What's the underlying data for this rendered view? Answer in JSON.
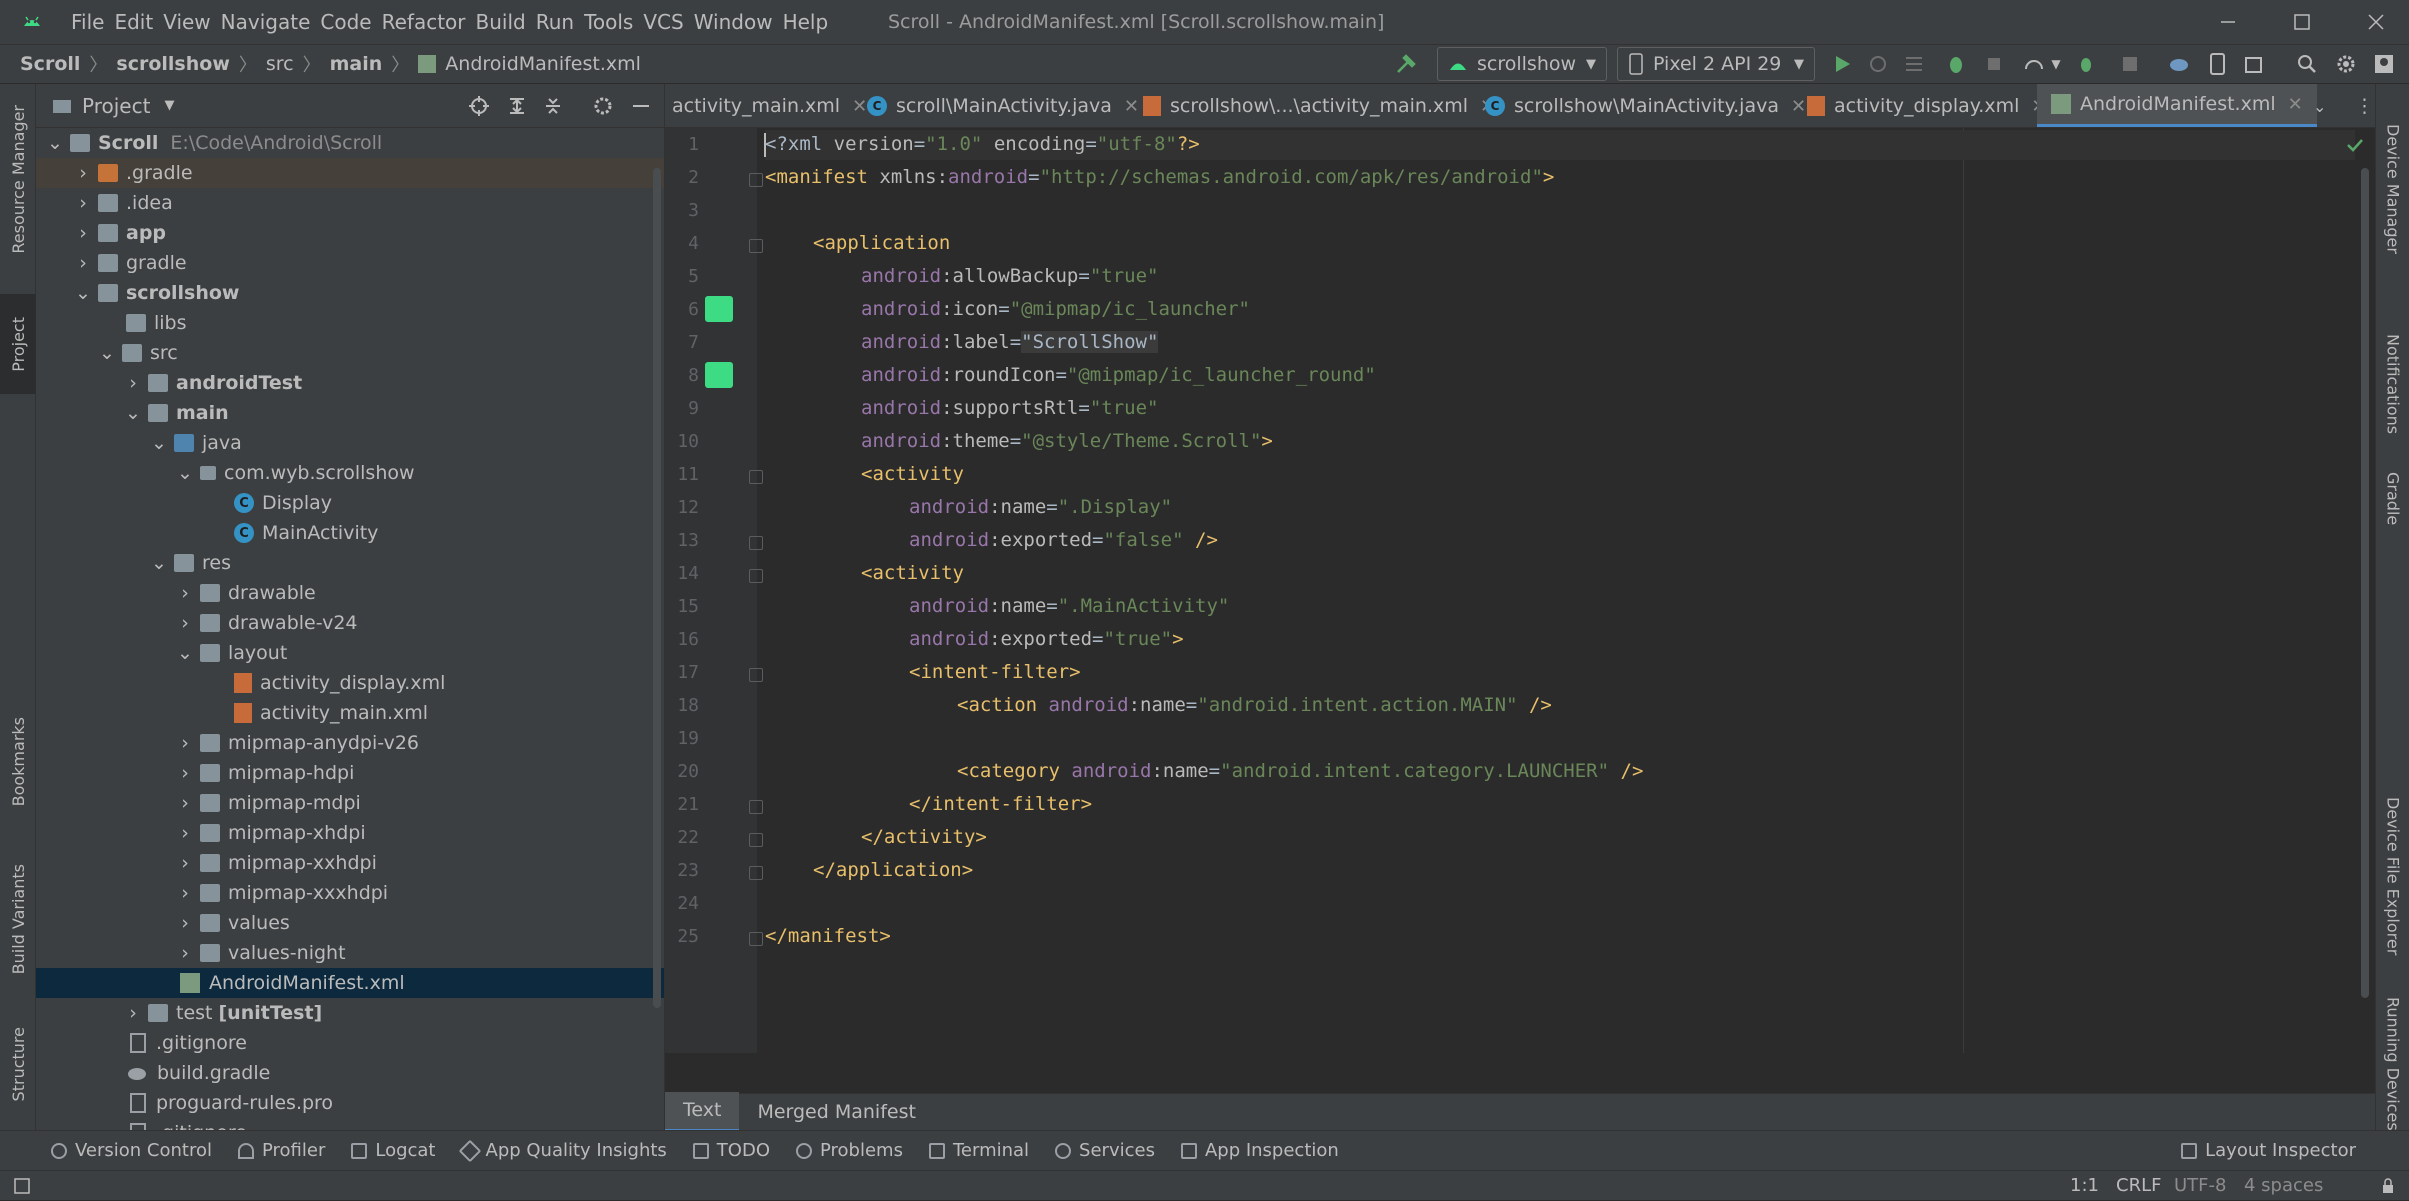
{
  "menubar": {
    "items": [
      "File",
      "Edit",
      "View",
      "Navigate",
      "Code",
      "Refactor",
      "Build",
      "Run",
      "Tools",
      "VCS",
      "Window",
      "Help"
    ],
    "window_title": "Scroll - AndroidManifest.xml [Scroll.scrollshow.main]"
  },
  "breadcrumbs": [
    "Scroll",
    "scrollshow",
    "src",
    "main",
    "AndroidManifest.xml"
  ],
  "toolbar": {
    "run_config": "scrollshow",
    "device": "Pixel 2 API 29"
  },
  "left_strip": [
    "Resource Manager",
    "Project",
    "Bookmarks",
    "Build Variants",
    "Structure"
  ],
  "right_strip": [
    "Device Manager",
    "Notifications",
    "Gradle",
    "Device File Explorer",
    "Running Devices"
  ],
  "project_panel": {
    "title": "Project",
    "tree": [
      {
        "label": "Scroll",
        "hint": "E:\\Code\\Android\\Scroll"
      },
      {
        "label": ".gradle"
      },
      {
        "label": ".idea"
      },
      {
        "label": "app"
      },
      {
        "label": "gradle"
      },
      {
        "label": "scrollshow"
      },
      {
        "label": "libs"
      },
      {
        "label": "src"
      },
      {
        "label": "androidTest"
      },
      {
        "label": "main"
      },
      {
        "label": "java"
      },
      {
        "label": "com.wyb.scrollshow"
      },
      {
        "label": "Display"
      },
      {
        "label": "MainActivity"
      },
      {
        "label": "res"
      },
      {
        "label": "drawable"
      },
      {
        "label": "drawable-v24"
      },
      {
        "label": "layout"
      },
      {
        "label": "activity_display.xml"
      },
      {
        "label": "activity_main.xml"
      },
      {
        "label": "mipmap-anydpi-v26"
      },
      {
        "label": "mipmap-hdpi"
      },
      {
        "label": "mipmap-mdpi"
      },
      {
        "label": "mipmap-xhdpi"
      },
      {
        "label": "mipmap-xxhdpi"
      },
      {
        "label": "mipmap-xxxhdpi"
      },
      {
        "label": "values"
      },
      {
        "label": "values-night"
      },
      {
        "label": "AndroidManifest.xml"
      },
      {
        "label": "test",
        "hint": "[unitTest]"
      },
      {
        "label": ".gitignore"
      },
      {
        "label": "build.gradle"
      },
      {
        "label": "proguard-rules.pro"
      },
      {
        "label": ".gitignore"
      }
    ]
  },
  "editor_tabs": [
    {
      "label": "activity_main.xml"
    },
    {
      "label": "scroll\\MainActivity.java"
    },
    {
      "label": "scrollshow\\...\\activity_main.xml"
    },
    {
      "label": "scrollshow\\MainActivity.java"
    },
    {
      "label": "activity_display.xml"
    },
    {
      "label": "AndroidManifest.xml"
    }
  ],
  "code": {
    "line_numbers": [
      "1",
      "2",
      "3",
      "4",
      "5",
      "6",
      "7",
      "8",
      "9",
      "10",
      "11",
      "12",
      "13",
      "14",
      "15",
      "16",
      "17",
      "18",
      "19",
      "20",
      "21",
      "22",
      "23",
      "24",
      "25"
    ],
    "l1": {
      "a": "<?xml ",
      "b": "version",
      "c": "=",
      "d": "\"1.0\"",
      "e": " encoding",
      "f": "=",
      "g": "\"utf-8\"",
      "h": "?>"
    },
    "l2": {
      "a": "<manifest ",
      "b": "xmlns:",
      "c": "android",
      "d": "=",
      "e": "\"http://schemas.android.com/apk/res/android\"",
      "f": ">"
    },
    "l4": "<application",
    "l5": {
      "ns": "android",
      "attr": ":allowBackup",
      "eq": "=",
      "val": "\"true\""
    },
    "l6": {
      "ns": "android",
      "attr": ":icon",
      "eq": "=",
      "val": "\"@mipmap/ic_launcher\""
    },
    "l7": {
      "ns": "android",
      "attr": ":label",
      "eq": "=",
      "val": "\"ScrollShow\""
    },
    "l8": {
      "ns": "android",
      "attr": ":roundIcon",
      "eq": "=",
      "val": "\"@mipmap/ic_launcher_round\""
    },
    "l9": {
      "ns": "android",
      "attr": ":supportsRtl",
      "eq": "=",
      "val": "\"true\""
    },
    "l10": {
      "ns": "android",
      "attr": ":theme",
      "eq": "=",
      "val": "\"@style/Theme.Scroll\"",
      "end": ">"
    },
    "l11": "<activity",
    "l12": {
      "ns": "android",
      "attr": ":name",
      "eq": "=",
      "val": "\".Display\""
    },
    "l13": {
      "ns": "android",
      "attr": ":exported",
      "eq": "=",
      "val": "\"false\"",
      "end": " />"
    },
    "l14": "<activity",
    "l15": {
      "ns": "android",
      "attr": ":name",
      "eq": "=",
      "val": "\".MainActivity\""
    },
    "l16": {
      "ns": "android",
      "attr": ":exported",
      "eq": "=",
      "val": "\"true\"",
      "end": ">"
    },
    "l17": "<intent-filter>",
    "l18": {
      "tag": "<action ",
      "ns": "android",
      "attr": ":name",
      "eq": "=",
      "val": "\"android.intent.action.MAIN\"",
      "end": " />"
    },
    "l20": {
      "tag": "<category ",
      "ns": "android",
      "attr": ":name",
      "eq": "=",
      "val": "\"android.intent.category.LAUNCHER\"",
      "end": " />"
    },
    "l21": "</intent-filter>",
    "l22": "</activity>",
    "l23": "</application>",
    "l25": "</manifest>"
  },
  "bottom_editor_tabs": [
    "Text",
    "Merged Manifest"
  ],
  "tool_windows": [
    "Version Control",
    "Profiler",
    "Logcat",
    "App Quality Insights",
    "TODO",
    "Problems",
    "Terminal",
    "Services",
    "App Inspection",
    "Layout Inspector"
  ],
  "status_bar": {
    "position": "1:1",
    "line_sep": "CRLF",
    "encoding": "UTF-8",
    "indent": "4 spaces"
  },
  "colors": {
    "accent": "#4a88c7",
    "android_green": "#3ddc84",
    "run_green": "#59a869"
  }
}
